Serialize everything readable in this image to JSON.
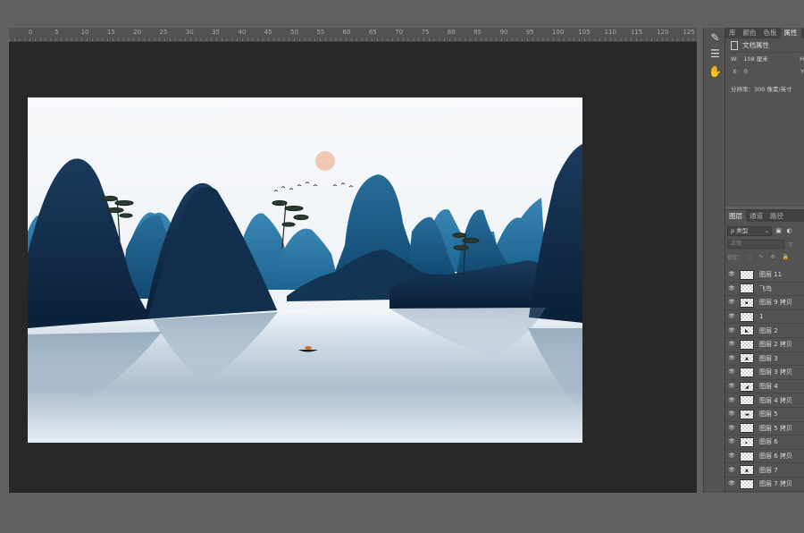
{
  "ruler": {
    "labels": [
      "0",
      "5",
      "10",
      "15",
      "20",
      "25",
      "30",
      "35",
      "40",
      "45",
      "50",
      "55",
      "60",
      "65",
      "70",
      "75",
      "80",
      "85",
      "90",
      "95",
      "100",
      "105",
      "110",
      "115",
      "120",
      "125"
    ]
  },
  "properties_panel": {
    "tabs": [
      "库",
      "颜色",
      "色板",
      "属性"
    ],
    "active_tab": "属性",
    "header": "文档属性",
    "width_label": "W:",
    "width_value": "108 厘米",
    "width_right": "H",
    "x_label": "X:",
    "x_value": "0",
    "x_right": "Y",
    "resolution": "分辨率：300 像素/英寸"
  },
  "tools": {
    "icons": [
      "brush-tool-icon",
      "adjust-sliders-icon",
      "hand-paint-icon"
    ]
  },
  "layers_panel": {
    "tabs": [
      "图层",
      "通道",
      "路径"
    ],
    "active_tab": "图层",
    "filter_label": "ρ 类型",
    "blend_mode": "正常",
    "blend_right": "不",
    "lock_label": "锁定：",
    "lock_icons": "⬚ ✎ ✥ 🔒",
    "layers": [
      {
        "name": "图层 11",
        "mark": ""
      },
      {
        "name": "飞鸟",
        "mark": ""
      },
      {
        "name": "图层 9 拷贝",
        "mark": "▪"
      },
      {
        "name": "1",
        "mark": ""
      },
      {
        "name": "图层 2",
        "mark": "◣"
      },
      {
        "name": "图层 2 拷贝",
        "mark": ""
      },
      {
        "name": "图层 3",
        "mark": "▲"
      },
      {
        "name": "图层 3 拷贝",
        "mark": ""
      },
      {
        "name": "图层 4",
        "mark": "◢"
      },
      {
        "name": "图层 4 拷贝",
        "mark": ""
      },
      {
        "name": "图层 5",
        "mark": "▬"
      },
      {
        "name": "图层 5 拷贝",
        "mark": ""
      },
      {
        "name": "图层 6",
        "mark": "▴"
      },
      {
        "name": "图层 6 拷贝",
        "mark": ""
      },
      {
        "name": "图层 7",
        "mark": "▲"
      },
      {
        "name": "图层 7 拷贝",
        "mark": ""
      }
    ]
  },
  "colors": {
    "app_background": "#616161",
    "canvas_background": "#282828",
    "panel": "#535353",
    "mountain_dark": "#0b2440",
    "mountain_mid": "#1a5a86",
    "water": "#dde6ee",
    "sun": "#f0c0a4"
  }
}
